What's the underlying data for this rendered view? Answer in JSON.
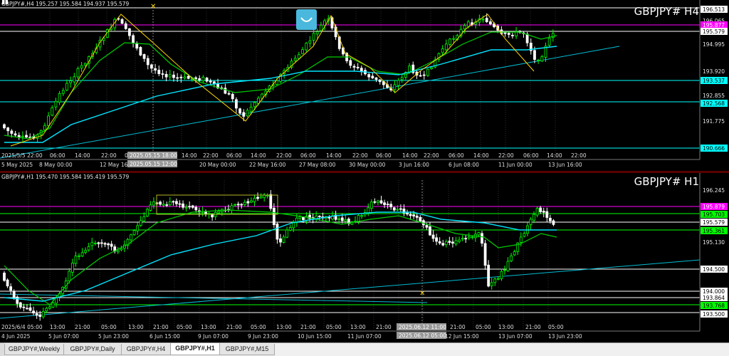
{
  "top": {
    "ohlc": "GBPJPY#,H4  195.257 195.584 194.937 195.579",
    "symbol": "GBPJPY# H4",
    "yticks": [
      "196.513",
      "196.065",
      "195.579",
      "194.995",
      "193.920",
      "192.855",
      "191.775",
      "190.666"
    ],
    "price_boxes": [
      {
        "text": "196.513",
        "bg": "#ffffff",
        "fg": "#000000"
      },
      {
        "text": "195.877",
        "bg": "#ff00ff",
        "fg": "#ffffff"
      },
      {
        "text": "195.579",
        "bg": "#ffffff",
        "fg": "#000000"
      },
      {
        "text": "193.537",
        "bg": "#00ffff",
        "fg": "#000000"
      },
      {
        "text": "192.568",
        "bg": "#00ffff",
        "fg": "#000000"
      },
      {
        "text": "190.666",
        "bg": "#00ffff",
        "fg": "#000000"
      }
    ],
    "xlabels": [
      "5 May 2025",
      "8 May 00:00",
      "12 May 16:00",
      "20 May 00:00",
      "22 May 16:00",
      "27 May 08:00",
      "30 May 00:00",
      "3 Jun 16:00",
      "6 Jun 08:00",
      "11 Jun 00:00",
      "13 Jun 16:00"
    ],
    "hour_labels": [
      "2025/5/5 22:00",
      "06:00",
      "14:00",
      "22:00",
      "06:00",
      "14:00",
      "22:00",
      "06:00",
      "14:00",
      "22:00",
      "06:00",
      "14:00",
      "22:00",
      "06:00",
      "14:00",
      "22:00",
      "06:00",
      "14:00",
      "22:00",
      "06:00",
      "14:00",
      "22:00"
    ],
    "crosshair_time": "2025.05.15 18:00",
    "crosshair_time2": "2025.05.15 12:00"
  },
  "bottom": {
    "ohlc": "GBPJPY#,H1  195.470 195.584 195.419 195.579",
    "symbol": "GBPJPY# H1",
    "yticks": [
      "196.245",
      "195.579",
      "195.130",
      "194.500",
      "194.000",
      "193.500"
    ],
    "price_boxes": [
      {
        "text": "195.879",
        "bg": "#ff00ff",
        "fg": "#ffffff"
      },
      {
        "text": "195.703",
        "bg": "#00ff00",
        "fg": "#000000"
      },
      {
        "text": "195.579",
        "bg": "#ffffff",
        "fg": "#000000"
      },
      {
        "text": "195.361",
        "bg": "#00ff00",
        "fg": "#000000"
      },
      {
        "text": "194.500",
        "bg": "#ffffff",
        "fg": "#000000"
      },
      {
        "text": "194.000",
        "bg": "#ffffff",
        "fg": "#000000"
      },
      {
        "text": "193.864",
        "bg": "#ffffff",
        "fg": "#000000"
      },
      {
        "text": "193.768",
        "bg": "#00ff00",
        "fg": "#000000"
      },
      {
        "text": "193.500",
        "bg": "#ffffff",
        "fg": "#000000"
      }
    ],
    "xlabels": [
      "4 Jun 2025",
      "5 Jun 07:00",
      "5 Jun 23:00",
      "6 Jun 15:00",
      "9 Jun 07:00",
      "9 Jun 23:00",
      "10 Jun 15:00",
      "11 Jun 07:00",
      "12 Jun 15:00",
      "13 Jun 07:00",
      "13 Jun 23:00"
    ],
    "hour_labels": [
      "2025/6/4 05:00",
      "13:00",
      "21:00",
      "05:00",
      "13:00",
      "21:00",
      "05:00",
      "13:00",
      "21:00",
      "05:00",
      "13:00",
      "21:00",
      "05:00",
      "13:00",
      "21:00",
      "05:00",
      "13:00",
      "21:00",
      "05:00",
      "13:00",
      "21:00",
      "05:00"
    ],
    "crosshair_time": "2025.06.12 11:00",
    "crosshair_time2": "2025.06.12 05:00"
  },
  "tabs": [
    "GBPJPY#,Weekly",
    "GBPJPY#,Daily",
    "GBPJPY#,H4",
    "GBPJPY#,H1",
    "GBPJPY#,M15"
  ],
  "active_tab": 3,
  "colors": {
    "bull": "#00ff00",
    "bear": "#ffffff",
    "ma_fast": "#00cc00",
    "ma_slow": "#00e5ff",
    "zigzag": "#ffd700",
    "level_magenta": "#ff00ff",
    "trend": "#00bcd4"
  }
}
